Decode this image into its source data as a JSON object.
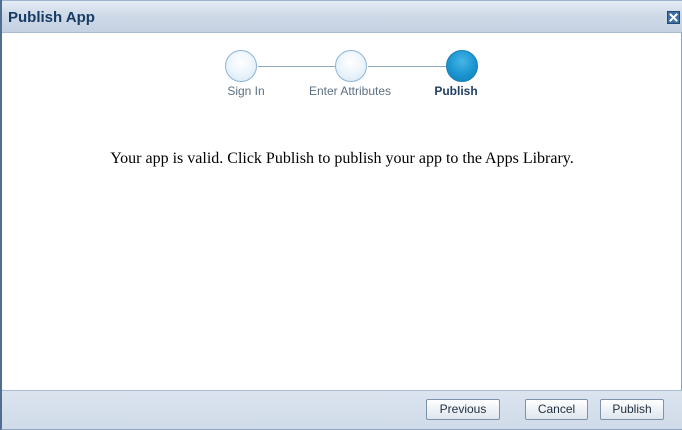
{
  "dialog": {
    "title": "Publish App",
    "close_icon": "close-icon"
  },
  "train": {
    "steps": [
      {
        "label": "Sign In",
        "state": "visited"
      },
      {
        "label": "Enter Attributes",
        "state": "visited"
      },
      {
        "label": "Publish",
        "state": "current"
      }
    ]
  },
  "main": {
    "message": "Your app is valid. Click Publish to publish your app to the Apps Library."
  },
  "footer": {
    "previous_label": "Previous",
    "cancel_label": "Cancel",
    "publish_label": "Publish"
  },
  "colors": {
    "title_bar": "#cfdae8",
    "current_step": "#1d97d2",
    "visited_step": "#eef6fc",
    "footer": "#d0dbe9"
  }
}
